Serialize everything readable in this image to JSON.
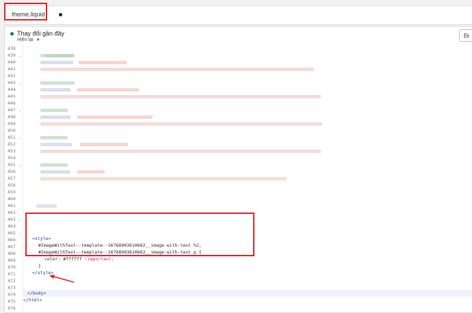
{
  "tab": {
    "filename": "theme.liquid"
  },
  "header": {
    "title": "Thay đổi gần đây",
    "subtitle": "Hiện tại",
    "action_label": "Đị"
  },
  "line_numbers": [
    "438",
    "439",
    "440",
    "441",
    "442",
    "443",
    "444",
    "445",
    "446",
    "447",
    "448",
    "449",
    "450",
    "451",
    "452",
    "453",
    "454",
    "455",
    "456",
    "457",
    "458",
    "459",
    "460",
    "461",
    "462",
    "463",
    "464",
    "465",
    "466",
    "467",
    "468",
    "469",
    "470",
    "471",
    "472",
    "473",
    "474",
    "475",
    "476"
  ],
  "fold_lines": [
    "439",
    "443",
    "447",
    "451",
    "455",
    "463",
    "465"
  ],
  "code": {
    "style_open": "<style>",
    "selector_h2": "#ImageWithText--template--16768903610662__image-with-text h2,",
    "selector_p": "#ImageWithText--template--16768903610662__image-with-text p {",
    "color_prop": "color: #ffffff ",
    "important": "!important;",
    "brace_close": "}",
    "style_close": "</style>",
    "body_close": "</body>",
    "html_close": "</html>"
  },
  "colors": {
    "highlight_box": "#e02020",
    "status_dot": "#1a7a4c"
  }
}
